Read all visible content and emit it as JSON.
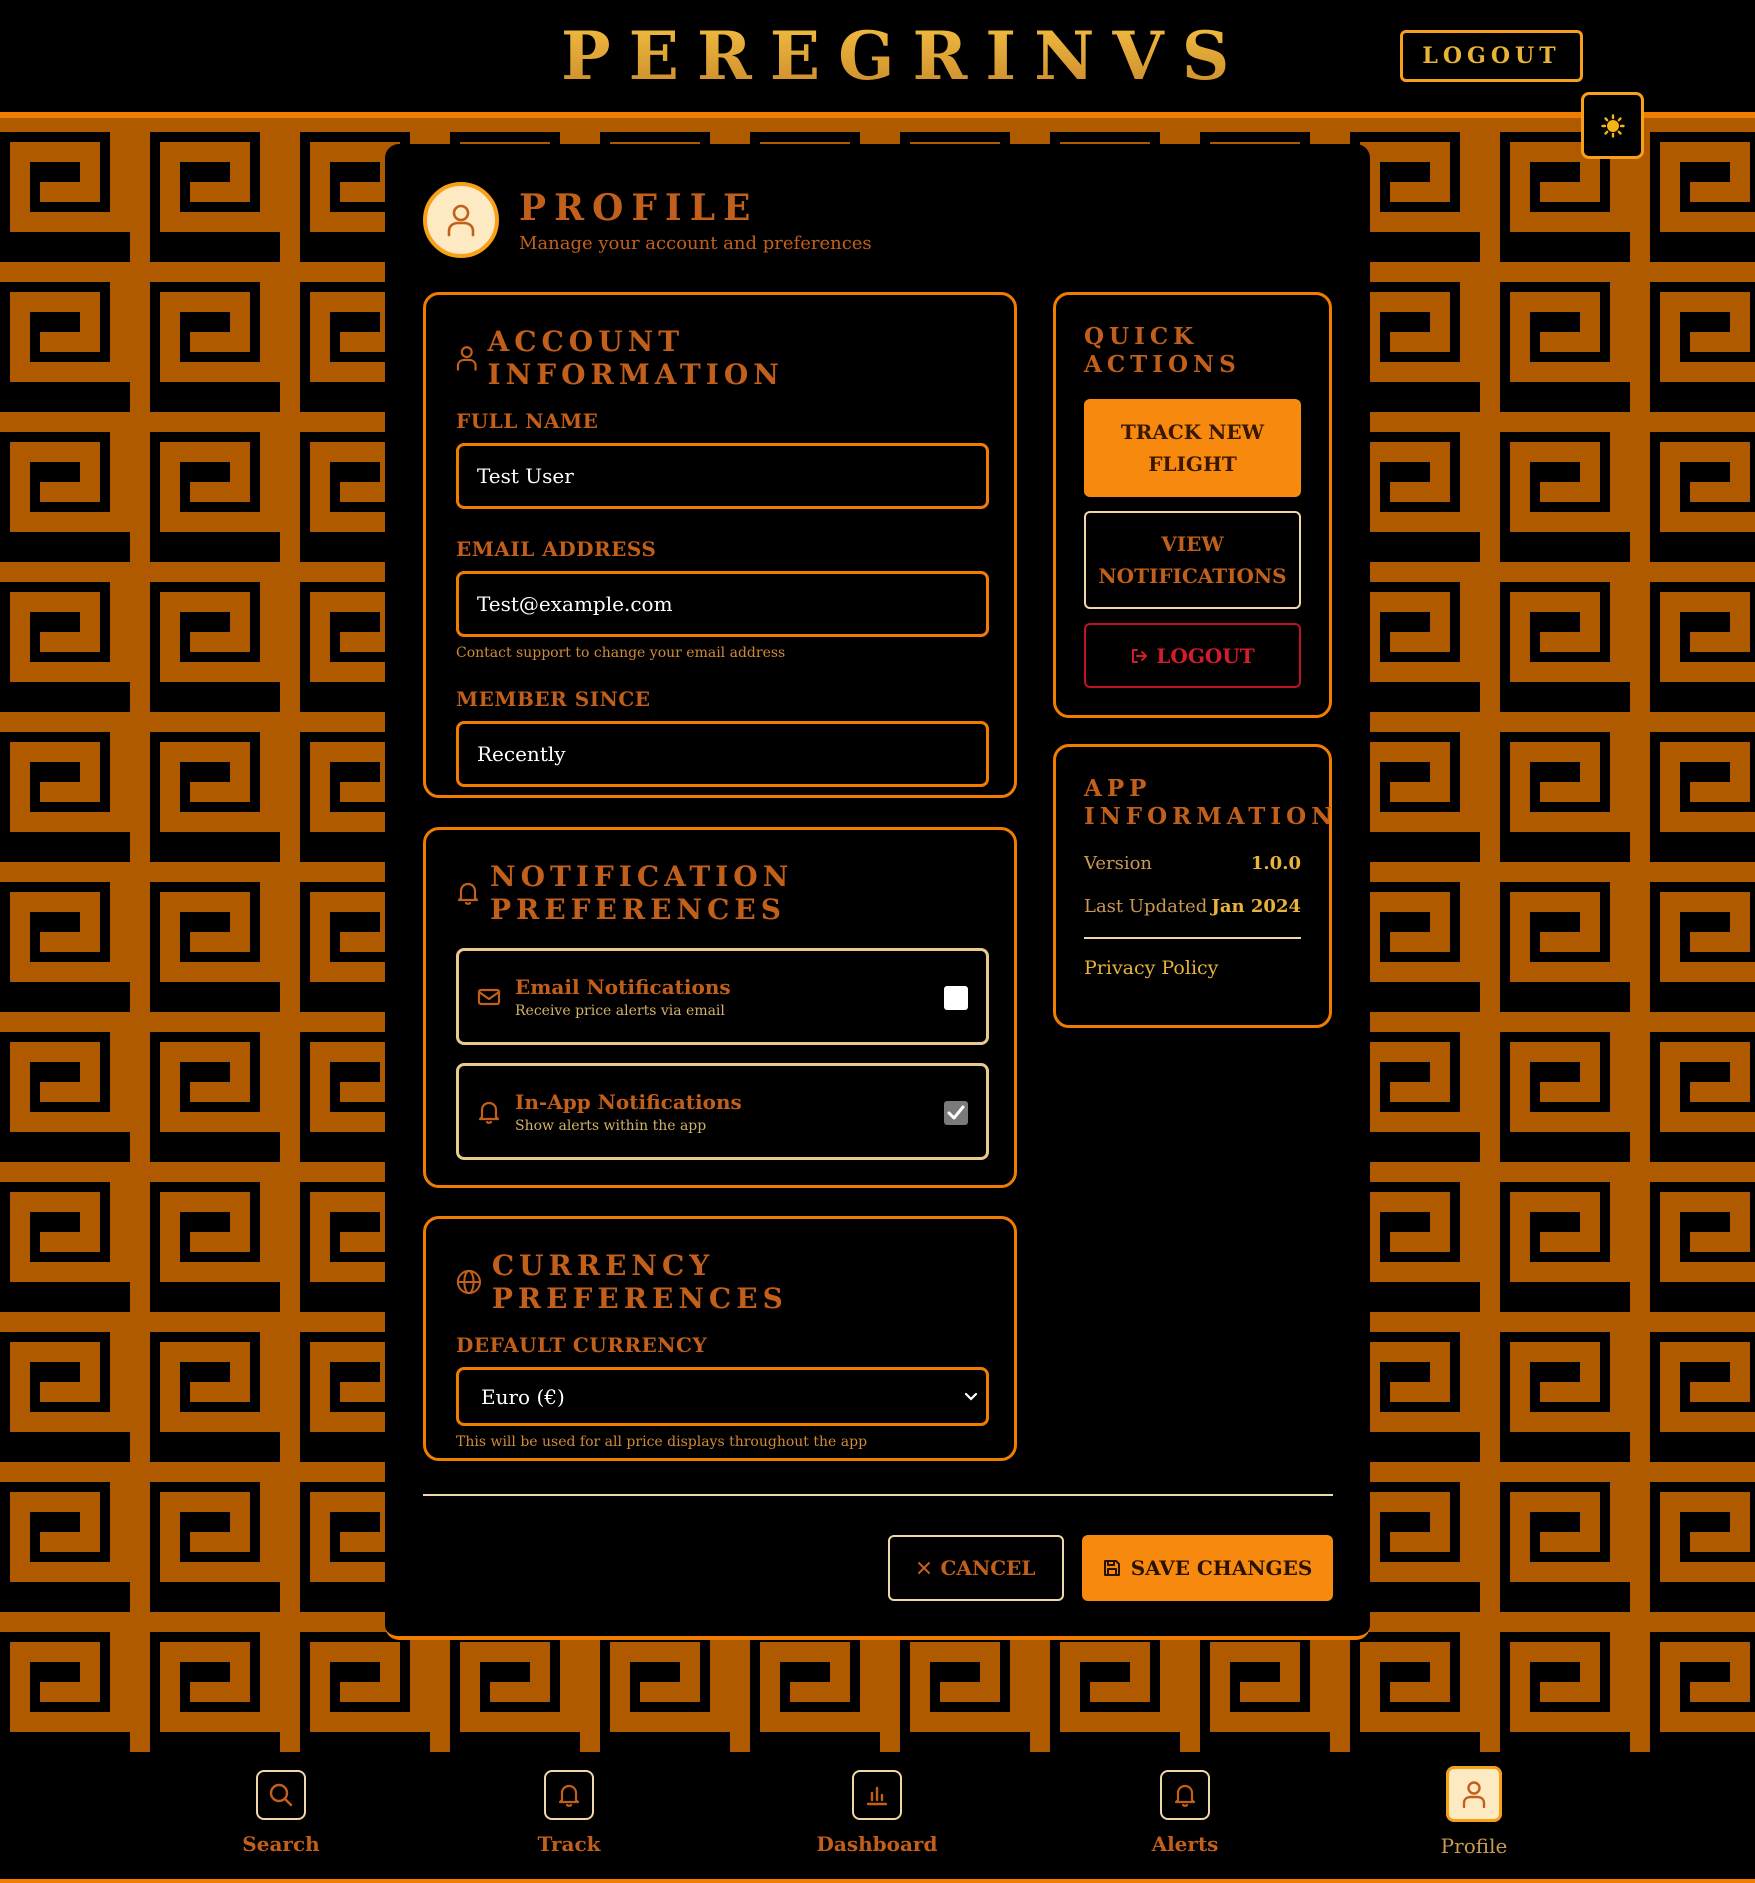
{
  "header": {
    "brand": "PEREGRINVS",
    "logout_label": "LOGOUT"
  },
  "profile": {
    "title": "PROFILE",
    "subtitle": "Manage your account and preferences"
  },
  "account": {
    "title": "ACCOUNT INFORMATION",
    "full_name_label": "FULL NAME",
    "full_name_value": "Test User",
    "email_label": "EMAIL ADDRESS",
    "email_value": "Test@example.com",
    "email_hint": "Contact support to change your email address",
    "member_label": "MEMBER SINCE",
    "member_value": "Recently"
  },
  "notifications": {
    "title_line1": "NOTIFICATION",
    "title_line2": "PREFERENCES",
    "email": {
      "title": "Email Notifications",
      "subtitle": "Receive price alerts via email",
      "checked": false
    },
    "inapp": {
      "title": "In-App Notifications",
      "subtitle": "Show alerts within the app",
      "checked": true
    }
  },
  "currency": {
    "title": "CURRENCY PREFERENCES",
    "label": "DEFAULT CURRENCY",
    "selected": "Euro (€)",
    "hint": "This will be used for all price displays throughout the app"
  },
  "quick_actions": {
    "title_line1": "QUICK",
    "title_line2": "ACTIONS",
    "track_line1": "TRACK NEW",
    "track_line2": "FLIGHT",
    "view_line1": "VIEW",
    "view_line2": "NOTIFICATIONS",
    "logout": "LOGOUT"
  },
  "app_info": {
    "title_line1": "APP",
    "title_line2": "INFORMATION",
    "version_label": "Version",
    "version_value": "1.0.0",
    "updated_label": "Last Updated",
    "updated_value": "Jan 2024",
    "privacy": "Privacy Policy"
  },
  "actions": {
    "cancel": "CANCEL",
    "save": "SAVE CHANGES"
  },
  "bottom_nav": {
    "items": [
      {
        "label": "Search",
        "icon": "search-icon"
      },
      {
        "label": "Track",
        "icon": "bell-icon"
      },
      {
        "label": "Dashboard",
        "icon": "bar-chart-icon"
      },
      {
        "label": "Alerts",
        "icon": "bell-icon"
      },
      {
        "label": "Profile",
        "icon": "user-icon",
        "active": true
      }
    ]
  },
  "colors": {
    "accent": "#f78a0e",
    "pattern": "#b05a00",
    "heading": "#c2601b",
    "gold": "#e8b33a",
    "danger": "#d41c2a"
  }
}
